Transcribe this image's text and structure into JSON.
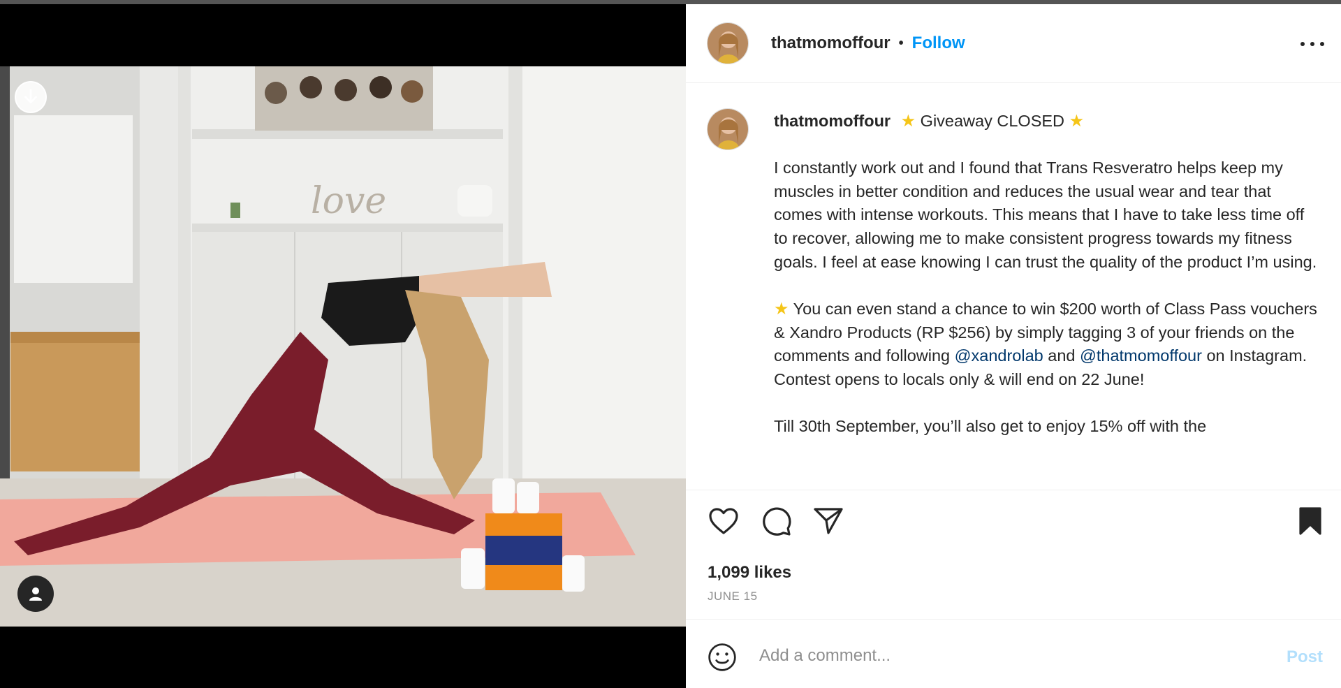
{
  "post": {
    "author": "thatmomoffour",
    "header_separator": "•",
    "follow_label": "Follow",
    "caption_title": "Giveaway CLOSED",
    "star_glyph": "★",
    "paragraph1": "I constantly work out and I found that Trans Resveratro helps keep my muscles in better condition and reduces the usual wear and tear that comes with intense workouts. This means that I have to take less time off to recover, allowing me to make consistent progress towards my fitness goals. I feel at ease knowing I can trust the quality of the product I’m using.",
    "paragraph2_start": "You can even stand a chance to win $200 worth of Class Pass vouchers & Xandro Products (RP $256) by simply tagging 3 of your friends on the comments and following",
    "mention1": "@xandrolab",
    "paragraph2_and": "and",
    "mention2": "@thatmomoffour",
    "paragraph2_end": "on Instagram. Contest opens to locals only & will end on 22 June!",
    "paragraph3": "Till 30th September, you’ll also get to enjoy 15% off with the",
    "likes": "1,099 likes",
    "date": "JUNE 15"
  },
  "comment": {
    "placeholder": "Add a comment...",
    "post_label": "Post"
  },
  "icons": {
    "download": "arrow-down-circle-icon",
    "tagged_user": "user-icon",
    "more": "more-horizontal-icon",
    "like": "heart-icon",
    "comment": "comment-bubble-icon",
    "share": "paper-plane-icon",
    "save": "bookmark-filled-icon",
    "emoji": "smiley-icon"
  },
  "colors": {
    "link_blue": "#0095f6",
    "mention_blue": "#00376b",
    "muted": "#8e8e8e",
    "post_disabled": "#b2dffc"
  }
}
